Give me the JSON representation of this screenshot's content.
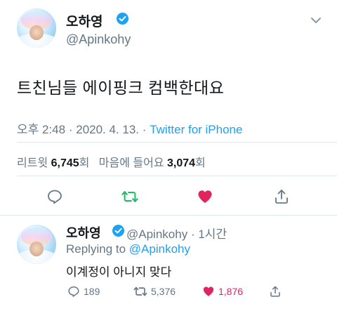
{
  "main_tweet": {
    "display_name": "오하영",
    "handle": "@Apinkohy",
    "text": "트친님들 에이핑크 컴백한대요",
    "time": "오후 2:48",
    "date": "2020. 4. 13.",
    "separator": "·",
    "source": "Twitter for iPhone",
    "retweets_label": "리트윗",
    "retweets_count": "6,745",
    "retweets_unit": "회",
    "likes_label": "마음에 들어요",
    "likes_count": "3,074",
    "likes_unit": "회"
  },
  "reply_tweet": {
    "display_name": "오하영",
    "handle": "@Apinkohy",
    "separator": "·",
    "time_ago": "1시간",
    "replying_prefix": "Replying to",
    "replying_to": "@Apinkohy",
    "text": "이계정이 아니지 맞다",
    "reply_count": "189",
    "retweet_count": "5,376",
    "like_count": "1,876"
  },
  "colors": {
    "accent": "#1da1f2",
    "retweet_green": "#17bf63",
    "like_red": "#e0245e",
    "secondary_text": "#657786"
  },
  "icons": [
    "verified-badge-icon",
    "chevron-down-icon",
    "reply-icon",
    "retweet-icon",
    "heart-icon",
    "share-icon"
  ]
}
